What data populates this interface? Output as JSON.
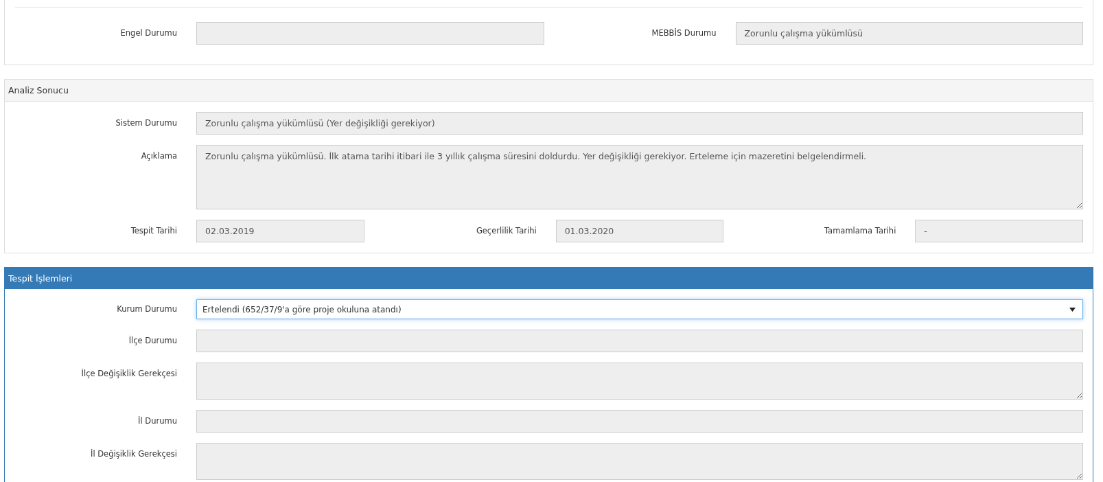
{
  "panels": [
    {
      "kind": "plain",
      "rows": [
        {
          "fields": [
            {
              "label": "Engel Durumu",
              "kind": "input",
              "disabled": true
            },
            {
              "label": "MEBBİS Durumu",
              "kind": "input",
              "disabled": true,
              "value": "Zorunlu çalışma yükümlüsü"
            }
          ]
        }
      ]
    },
    {
      "kind": "default",
      "title": "Analiz Sonucu",
      "rows": [
        {
          "fields": [
            {
              "label": "Sistem Durumu",
              "kind": "input",
              "disabled": true,
              "value": "Zorunlu çalışma yükümlüsü (Yer değişikliği gerekiyor)"
            }
          ]
        },
        {
          "fields": [
            {
              "label": "Açıklama",
              "kind": "memo",
              "disabled": true,
              "value": "Zorunlu çalışma yükümlüsü. İlk atama tarihi itibari ile 3 yıllık çalışma süresini doldurdu. Yer değişikliği gerekiyor. Erteleme için mazeretini belgelendirmeli."
            }
          ]
        },
        {
          "fields": [
            {
              "label": "Tespit Tarihi",
              "kind": "input",
              "disabled": true,
              "value": "02.03.2019"
            },
            {
              "label": "Geçerlilik Tarihi",
              "kind": "input",
              "disabled": true,
              "value": "01.03.2020"
            },
            {
              "label": "Tamamlama Tarihi",
              "kind": "input",
              "disabled": true,
              "value": "-"
            }
          ]
        }
      ]
    },
    {
      "kind": "primary",
      "title": "Tespit İşlemleri",
      "rows": [
        {
          "fields": [
            {
              "label": "Kurum Durumu",
              "kind": "select",
              "disabled": false,
              "value": "Ertelendi (652/37/9'a göre proje okuluna atandı)"
            }
          ]
        },
        {
          "fields": [
            {
              "label": "İlçe Durumu",
              "kind": "input",
              "disabled": true
            }
          ]
        },
        {
          "fields": [
            {
              "label": "İlçe Değişiklik Gerekçesi",
              "kind": "textarea",
              "disabled": true
            }
          ]
        },
        {
          "fields": [
            {
              "label": "İl Durumu",
              "kind": "input",
              "disabled": true
            }
          ]
        },
        {
          "fields": [
            {
              "label": "İl Değişiklik Gerekçesi",
              "kind": "textarea",
              "disabled": true
            }
          ]
        }
      ]
    }
  ]
}
